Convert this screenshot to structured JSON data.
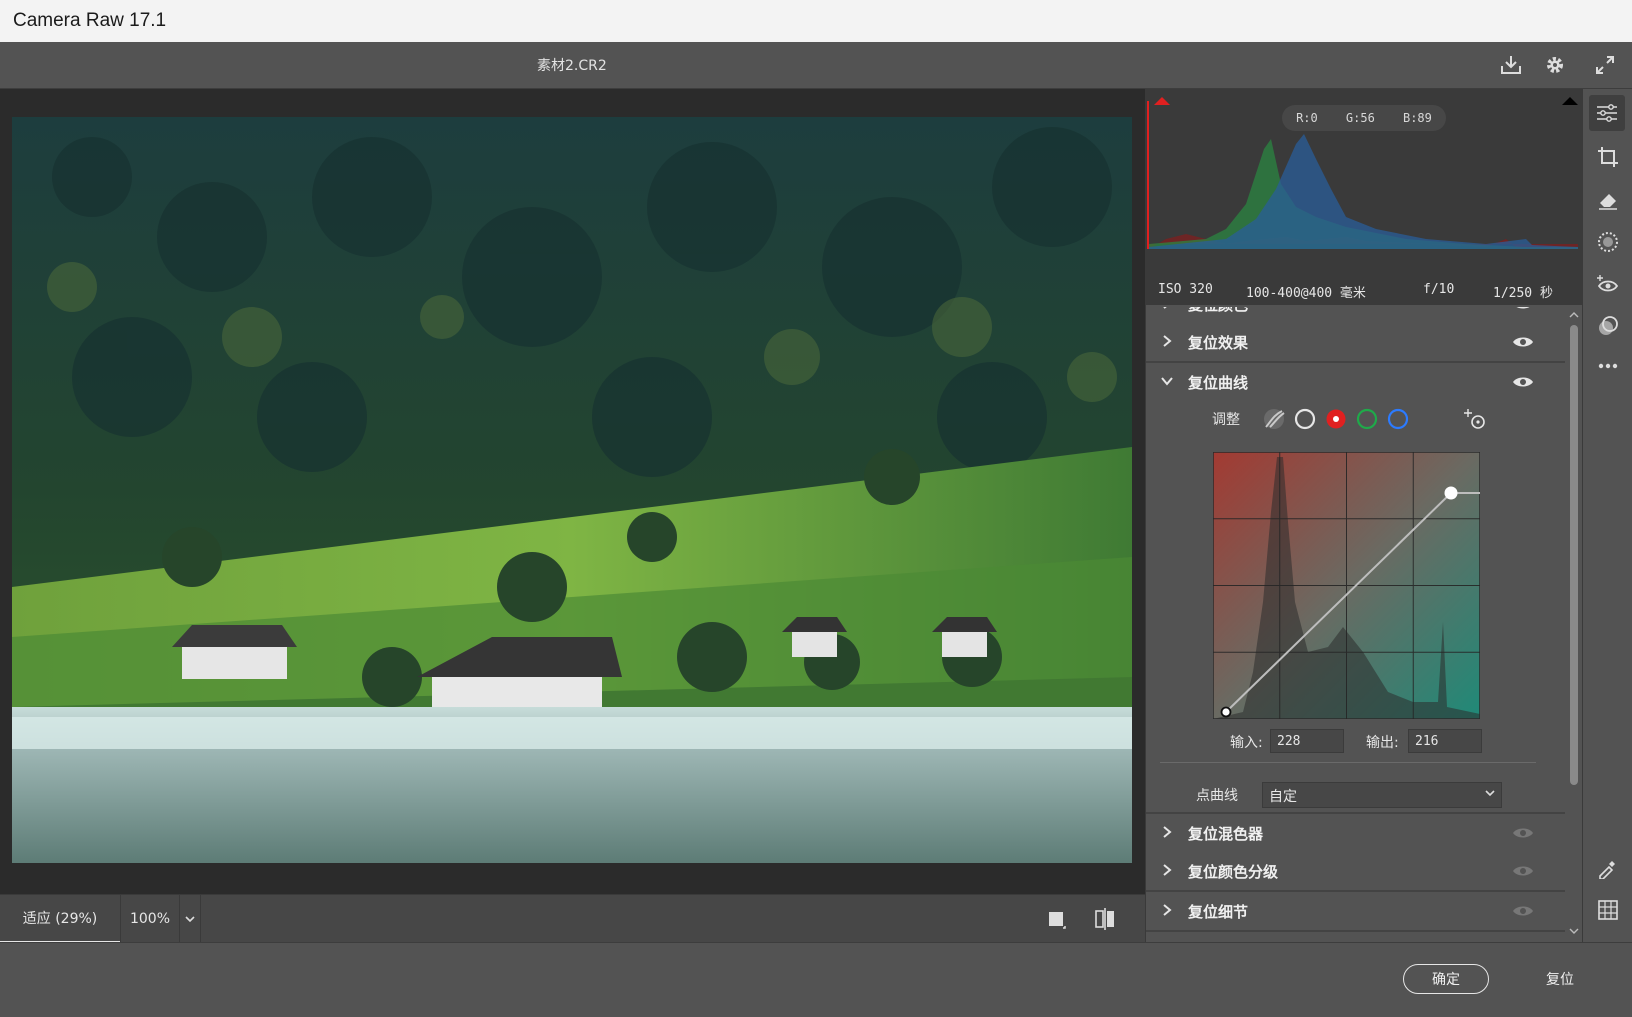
{
  "window": {
    "title": "Camera Raw 17.1"
  },
  "topbar": {
    "filename": "素材2.CR2"
  },
  "histogram": {
    "r_label": "R:0",
    "g_label": "G:56",
    "b_label": "B:89"
  },
  "exif": {
    "iso": "ISO 320",
    "lens": "100-400@400 毫米",
    "aperture": "f/10",
    "shutter": "1/250 秒"
  },
  "sections": {
    "color": "复位颜色",
    "effects": "复位效果",
    "curve": "复位曲线",
    "mixer": "复位混色器",
    "grading": "复位颜色分级",
    "detail": "复位细节"
  },
  "curve": {
    "adjust_label": "调整",
    "input_label": "输入:",
    "input_value": "228",
    "output_label": "输出:",
    "output_value": "216",
    "point_curve_label": "点曲线",
    "point_curve_value": "自定"
  },
  "bottom": {
    "zoom_fit": "适应 (29%)",
    "zoom_100": "100%"
  },
  "footer": {
    "ok": "确定",
    "reset": "复位"
  },
  "colors": {
    "accent_red": "#e02020",
    "curve_green": "#1faa4a",
    "curve_blue": "#2c7bff"
  }
}
